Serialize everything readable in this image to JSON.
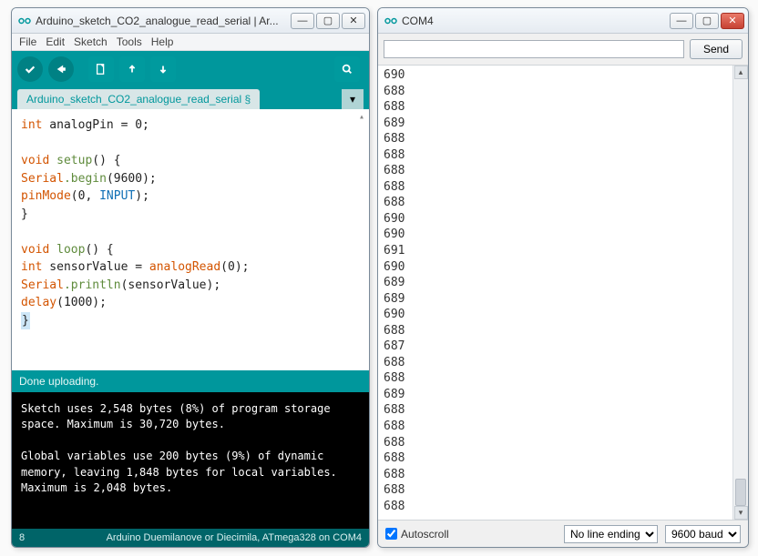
{
  "ide": {
    "title": "Arduino_sketch_CO2_analogue_read_serial | Ar...",
    "menu": [
      "File",
      "Edit",
      "Sketch",
      "Tools",
      "Help"
    ],
    "tab_label": "Arduino_sketch_CO2_analogue_read_serial §",
    "code": {
      "l1_kw": "int",
      "l1_rest": " analogPin = 0;",
      "l3_kw": "void",
      "l3_name": " setup",
      "l3_rest": "() {",
      "l4_a": "Serial",
      "l4_b": ".begin",
      "l4_c": "(9600);",
      "l5_a": "pinMode",
      "l5_b": "(0, ",
      "l5_c": "INPUT",
      "l5_d": ");",
      "l6": "}",
      "l8_kw": "void",
      "l8_name": " loop",
      "l8_rest": "() {",
      "l9_a": "int",
      "l9_b": " sensorValue = ",
      "l9_c": "analogRead",
      "l9_d": "(0);",
      "l10_a": "Serial",
      "l10_b": ".println",
      "l10_c": "(sensorValue);",
      "l11_a": "delay",
      "l11_b": "(1000);",
      "l12": "}"
    },
    "status": "Done uploading.",
    "console_line1": "Sketch uses 2,548 bytes (8%) of program storage space. Maximum is 30,720 bytes.",
    "console_line2": "Global variables use 200 bytes (9%) of dynamic memory, leaving 1,848 bytes for local variables. Maximum is 2,048 bytes.",
    "footer_left": "8",
    "footer_right": "Arduino Duemilanove or Diecimila, ATmega328 on COM4"
  },
  "serial": {
    "title": "COM4",
    "send_label": "Send",
    "output": "690\n688\n688\n689\n688\n688\n688\n688\n688\n690\n690\n691\n690\n689\n689\n690\n688\n687\n688\n688\n689\n688\n688\n688\n688\n688\n688\n688",
    "autoscroll_label": "Autoscroll",
    "line_ending_options": [
      "No line ending"
    ],
    "line_ending_selected": "No line ending",
    "baud_options": [
      "9600 baud"
    ],
    "baud_selected": "9600 baud"
  }
}
